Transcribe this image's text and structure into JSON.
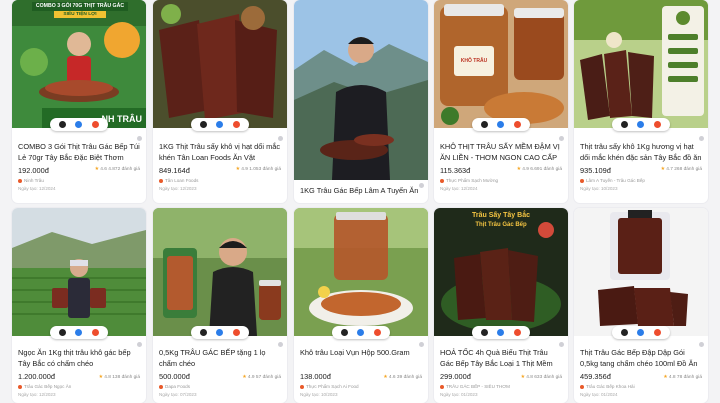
{
  "colors": {
    "accent": "#e85a2a",
    "star": "#f5a623",
    "price": "#222222"
  },
  "products": [
    {
      "title": "COMBO 3 Gói Thịt Trâu Gác Bếp Túi Lẻ 70gr Tây Bắc Đặc Biệt Thơm Ngo...",
      "price": "192.000đ",
      "rating": "4.6",
      "sold": "4.872 đánh giá",
      "shop": "Ninh Trâu",
      "date": "Ngày tạo: 12/2024",
      "banner_top": "COMBO 3 GÓI 70G THỊT TRÂU GÁC BẾP",
      "banner_sub": "SIÊU TIỆN LỢI",
      "brand": "NH TRÂU"
    },
    {
      "title": "1KG Thịt Trâu sấy khô vị hạt dổi mắc khén Tân Loan Foods Ăn Vặt Snack...",
      "price": "849.164đ",
      "rating": "4.9",
      "sold": "1.053 đánh giá",
      "shop": "Tân Loan Foods",
      "date": "Ngày tạo: 12/2023"
    },
    {
      "title": "1KG Trâu Gác Bếp Lâm A Tuyến Ăn",
      "price": "",
      "rating": "",
      "sold": "",
      "shop": "",
      "date": ""
    },
    {
      "title": "KHÔ THỊT TRÂU SẤY MỀM ĐẬM VỊ ĂN LIỀN - THƠM NGON CAO CẤP",
      "price": "115.363đ",
      "rating": "4.9",
      "sold": "6.691 đánh giá",
      "shop": "Thực Phẩm Sạch Mường",
      "date": "Ngày tạo: 12/2024",
      "label": "KHÔ TRÂU"
    },
    {
      "title": "Thịt trâu sấy khô 1Kg hương vị hạt dổi mắc khén đặc sản Tây Bắc đồ ăn vặt...",
      "price": "935.109đ",
      "rating": "4.7",
      "sold": "268 đánh giá",
      "shop": "Lâm A Tuyến - Trâu Gác Bếp",
      "date": "Ngày tạo: 10/2023"
    },
    {
      "title": "Ngọc Ăn 1Kg thịt trâu khô gác bếp Tây Bắc có chấm chéo",
      "price": "1.200.000đ",
      "rating": "4.8",
      "sold": "138 đánh giá",
      "shop": "Trâu Gác Bếp Ngọc Ăn",
      "date": "Ngày tạo: 12/2023"
    },
    {
      "title": "0,5Kg TRÂU GÁC BẾP tặng 1 lọ chẩm chéo",
      "price": "500.000đ",
      "rating": "4.9",
      "sold": "57 đánh giá",
      "shop": "Dapa Foods",
      "date": "Ngày tạo: 07/2023"
    },
    {
      "title": "Khô trâu Loại Vụn Hộp 500.Gram",
      "price": "138.000đ",
      "rating": "4.6",
      "sold": "39 đánh giá",
      "shop": "Thực Phẩm Sạch Ai Food",
      "date": "Ngày tạo: 10/2023"
    },
    {
      "title": "HOẢ TỐC 4h Quà Biếu Thịt Trâu Gác Bếp Tây Bắc Loại 1 Thịt Mềm Và Ngo...",
      "price": "299.000đ",
      "rating": "4.8",
      "sold": "633 đánh giá",
      "shop": "TRÂU GÁC BẾP - SIÊU THƠM",
      "date": "Ngày tạo: 01/2023",
      "banner_top": "Trâu Sấy Tây Bắc",
      "banner_sub": "Thịt Trâu Gác Bếp"
    },
    {
      "title": "Thịt Trâu Gác Bếp Đập Dập Gói 0,5kg tang chẩm chéo 100ml Đồ Ăn Vặt...",
      "price": "459.356đ",
      "rating": "4.8",
      "sold": "78 đánh giá",
      "shop": "Trâu Gác Bếp Khoa Hải",
      "date": "Ngày tạo: 01/2024"
    }
  ],
  "icons": {
    "badge": [
      "tiktok-icon",
      "zalo-icon",
      "shopee-icon"
    ],
    "star": "star-icon",
    "shop": "shop-dot-icon"
  }
}
